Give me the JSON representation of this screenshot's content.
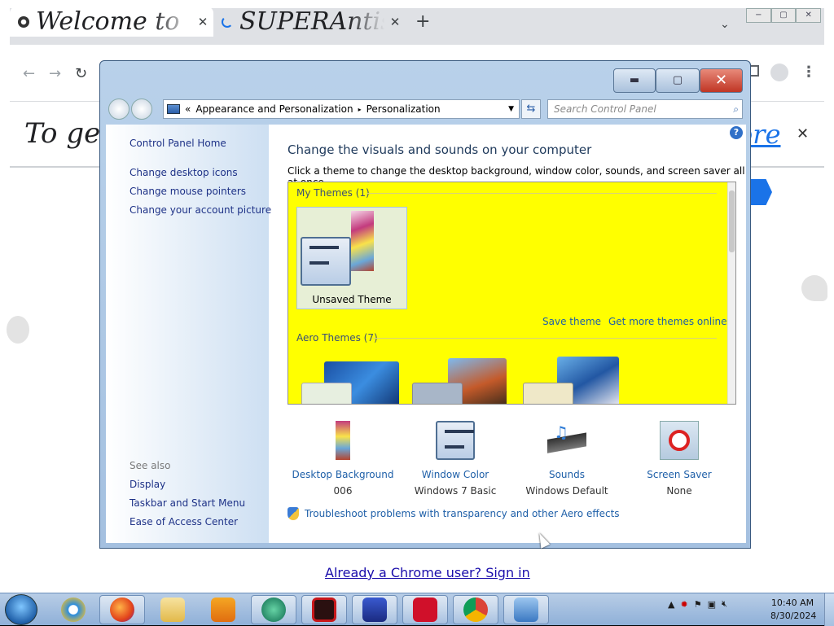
{
  "chrome": {
    "tabs": [
      {
        "title": "Welcome to",
        "active": true
      },
      {
        "title": "SUPERAntis",
        "active": false
      }
    ],
    "new_tab": "+",
    "tab_close": "✕",
    "tabs_dropdown": "⌄",
    "window_controls": [
      "−",
      "▢",
      "✕"
    ],
    "nav": {
      "back": "←",
      "forward": "→",
      "reload": "↻"
    },
    "banner_text": "To get",
    "banner_link": "ore",
    "banner_close": "✕",
    "signin_link": "Already a Chrome user? Sign in"
  },
  "control_panel": {
    "breadcrumb": {
      "prefix": "«",
      "items": [
        "Appearance and Personalization",
        "Personalization"
      ],
      "separator": "▸"
    },
    "search_placeholder": "Search Control Panel",
    "controls": {
      "minimize": "▬",
      "maximize": "▢",
      "close": "✕"
    },
    "left_links": [
      "Control Panel Home",
      "Change desktop icons",
      "Change mouse pointers",
      "Change your account picture"
    ],
    "see_also_label": "See also",
    "see_also_links": [
      "Display",
      "Taskbar and Start Menu",
      "Ease of Access Center"
    ],
    "heading": "Change the visuals and sounds on your computer",
    "subheading": "Click a theme to change the desktop background, window color, sounds, and screen saver all at once.",
    "my_themes_label": "My Themes (1)",
    "unsaved_theme_label": "Unsaved Theme",
    "save_theme": "Save theme",
    "get_more_themes": "Get more themes online",
    "aero_themes_label": "Aero Themes (7)",
    "themes_bg_color": "#ffff00",
    "options": [
      {
        "label": "Desktop Background",
        "value": "006",
        "icon": "desktop-background-icon"
      },
      {
        "label": "Window Color",
        "value": "Windows 7 Basic",
        "icon": "window-color-icon"
      },
      {
        "label": "Sounds",
        "value": "Windows Default",
        "icon": "sounds-icon"
      },
      {
        "label": "Screen Saver",
        "value": "None",
        "icon": "screen-saver-icon"
      }
    ],
    "troubleshoot": "Troubleshoot problems with transparency and other Aero effects"
  },
  "taskbar": {
    "apps": [
      "internet-explorer",
      "firefox",
      "file-explorer",
      "media-player",
      "app-green",
      "app-red-gear",
      "app-blue",
      "app-red-camera",
      "chrome",
      "control-panel"
    ],
    "time": "10:40 AM",
    "date": "8/30/2024"
  }
}
